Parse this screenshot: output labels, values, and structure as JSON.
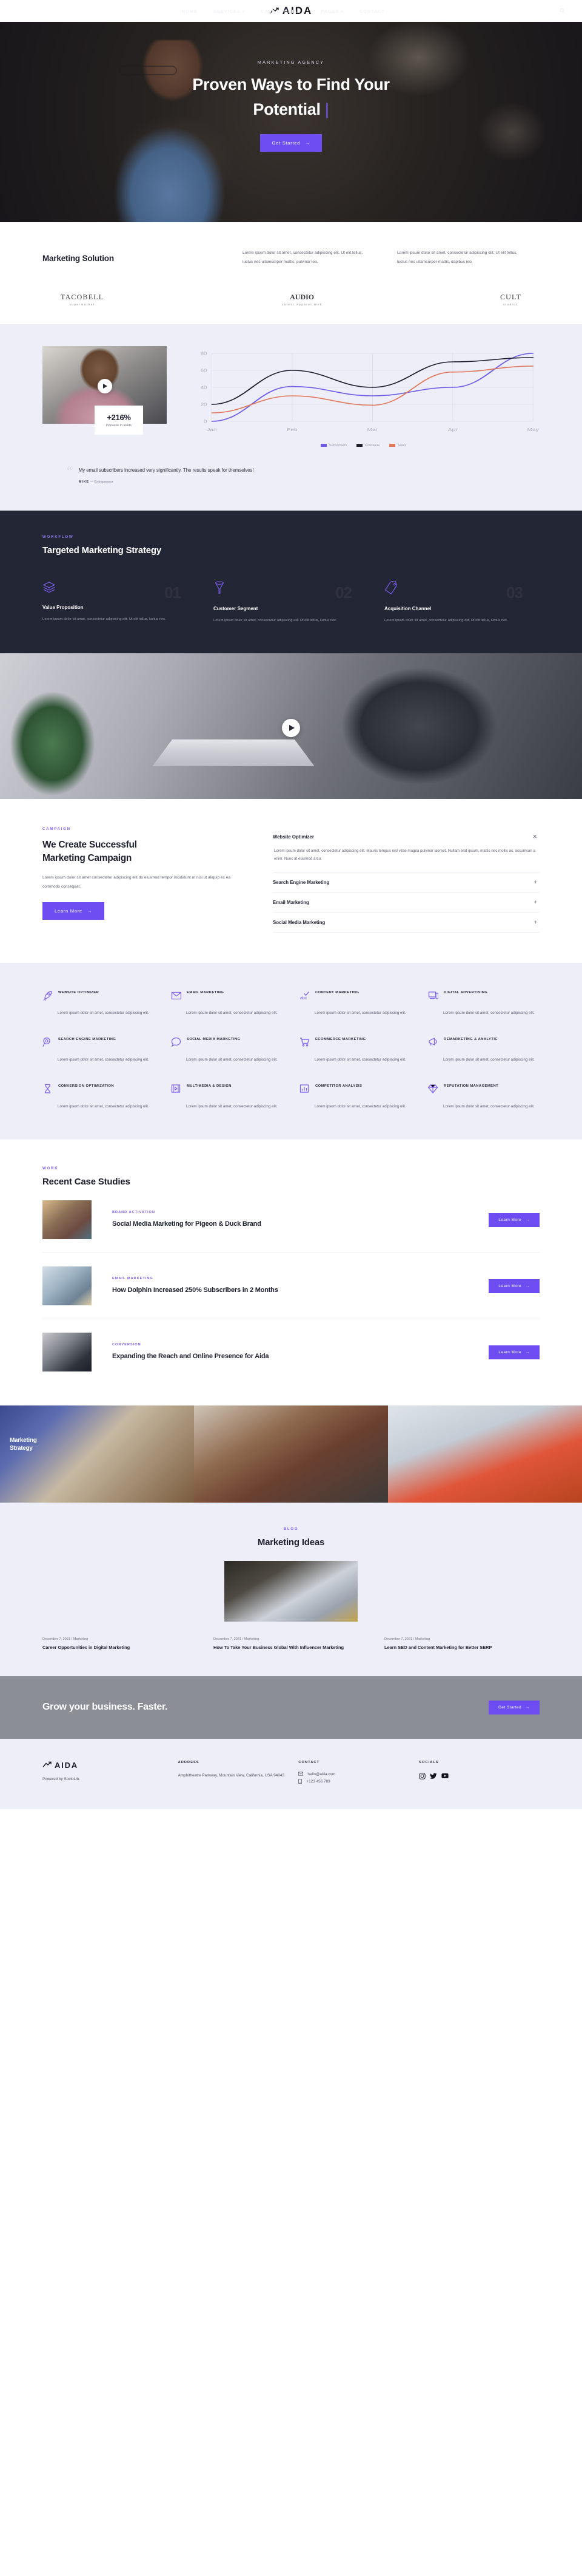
{
  "brand": {
    "name": "AIDA",
    "mark_icon": "trend-up-icon"
  },
  "nav": {
    "items": [
      {
        "label": "HOME",
        "has_caret": false
      },
      {
        "label": "SERVICES",
        "has_caret": true
      },
      {
        "label": "CASE STUDIES",
        "has_caret": true
      },
      {
        "label": "PAGES",
        "has_caret": true
      },
      {
        "label": "CONTACT",
        "has_caret": false
      }
    ],
    "search_icon": "search-icon"
  },
  "hero": {
    "eyebrow": "MARKETING AGENCY",
    "title_line1": "Proven Ways to Find Your",
    "title_line2": "Potential",
    "caret": "|",
    "cta": "Get Started",
    "cta_arrow": "→"
  },
  "solution": {
    "heading": "Marketing Solution",
    "col1": "Lorem ipsum dolor sit amet, consectetur adipiscing elit. Ut elit tellus, luctus nec ullamcorper mattis, pulvinar leo.",
    "col2": "Lorem ipsum dolor sit amet, consectetur adipiscing elit. Ut elit tellus, luctus nec ullamcorper mattis, dapibus leo.",
    "logos": [
      {
        "name": "TACOBELL",
        "sub": "supermarket"
      },
      {
        "name": "AUDIO",
        "sub": "Latest Apparel Web"
      },
      {
        "name": "CULT",
        "sub": "studios"
      }
    ]
  },
  "chart_section": {
    "stat_value": "+216%",
    "stat_label": "increase in leads",
    "play_icon": "play-icon",
    "quote": "My email subscribers increased very significantly. The results speak for themselves!",
    "quote_author": "MIKE",
    "quote_dash": "—",
    "quote_role": "Entrepeneur"
  },
  "chart_data": {
    "type": "line",
    "title": "",
    "xlabel": "",
    "ylabel": "",
    "x": [
      "Jan",
      "Feb",
      "Mar",
      "Apr",
      "May"
    ],
    "ylim": [
      0,
      80
    ],
    "yticks": [
      0,
      20,
      40,
      60,
      80
    ],
    "grid": true,
    "legend_position": "bottom",
    "series": [
      {
        "name": "Subscribers",
        "color": "#6c5ce7",
        "values": [
          0,
          41,
          30,
          40,
          80
        ]
      },
      {
        "name": "Followers",
        "color": "#1d1f2e",
        "values": [
          20,
          60,
          40,
          70,
          75
        ]
      },
      {
        "name": "Sales",
        "color": "#e0795b",
        "values": [
          10,
          30,
          19,
          58,
          65
        ]
      }
    ]
  },
  "workflow": {
    "eyebrow": "WORKFLOW",
    "heading": "Targeted Marketing Strategy",
    "steps": [
      {
        "num": "01",
        "icon": "layers-icon",
        "title": "Value Proposition",
        "desc": "Lorem ipsum dolor sit amet, consectetur adipiscing elit. Ut elit tellus, luctus nec."
      },
      {
        "num": "02",
        "icon": "funnel-icon",
        "title": "Customer Segment",
        "desc": "Lorem ipsum dolor sit amet, consectetur adipiscing elit. Ut elit tellus, luctus nec."
      },
      {
        "num": "03",
        "icon": "tag-icon",
        "title": "Acquisition Channel",
        "desc": "Lorem ipsum dolor sit amet, consectetur adipiscing elit. Ut elit tellus, luctus nec."
      }
    ]
  },
  "banner": {
    "play_icon": "play-icon"
  },
  "campaign": {
    "eyebrow": "CAMPAIGN",
    "heading_line1": "We Create Successful",
    "heading_line2": "Marketing Campaign",
    "desc": "Lorem ipsum dolor sit amet consectetur adipiscing elit do eiusmod tempor incididunt ut  nisi ut aliquip ex ea commodo consequat.",
    "cta": "Learn More",
    "cta_arrow": "→",
    "accordion": [
      {
        "title": "Website Optimizer",
        "sign": "✕",
        "open": true,
        "body": "Lorem ipsum dolor sit amet, consectetur adipiscing elit. Mauris tempus nisl vitae magna pulvinar laoreet. Nullam erat ipsum, mattis nec mollis ac, accumsan a enim. Nunc at euismod arcu."
      },
      {
        "title": "Search Engine Marketing",
        "sign": "+",
        "open": false,
        "body": ""
      },
      {
        "title": "Email Marketing",
        "sign": "+",
        "open": false,
        "body": ""
      },
      {
        "title": "Social Media Marketing",
        "sign": "+",
        "open": false,
        "body": ""
      }
    ]
  },
  "services": {
    "items": [
      {
        "icon": "rocket-icon",
        "name": "WEBSITE OPTIMIZER",
        "desc": "Lorem ipsum dolor sit amet, consectetur adipiscing elit."
      },
      {
        "icon": "envelope-icon",
        "name": "EMAIL MARKETING",
        "desc": "Lorem ipsum dolor sit amet, consectetur adipiscing elit."
      },
      {
        "icon": "abc-check-icon",
        "name": "CONTENT MARKETING",
        "desc": "Lorem ipsum dolor sit amet, consectetur adipiscing elit."
      },
      {
        "icon": "devices-icon",
        "name": "DIGITAL ADVERTISING",
        "desc": "Lorem ipsum dolor sit amet, consectetur adipiscing elit."
      },
      {
        "icon": "magnifier-icon",
        "name": "SEARCH ENGINE MARKETING",
        "desc": "Lorem ipsum dolor sit amet, consectetur adipiscing elit."
      },
      {
        "icon": "chat-bubble-icon",
        "name": "SOCIAL MEDIA MARKETING",
        "desc": "Lorem ipsum dolor sit amet, consectetur adipiscing elit."
      },
      {
        "icon": "cart-icon",
        "name": "ECOMMERCE MARKETING",
        "desc": "Lorem ipsum dolor sit amet, consectetur adipiscing elit."
      },
      {
        "icon": "megaphone-icon",
        "name": "REMARKETING & ANALYTIC",
        "desc": "Lorem ipsum dolor sit amet, consectetur adipiscing elit."
      },
      {
        "icon": "hourglass-icon",
        "name": "CONVERSION OPTIMIZATION",
        "desc": "Lorem ipsum dolor sit amet, consectetur adipiscing elit."
      },
      {
        "icon": "film-icon",
        "name": "MULTIMEDIA & DESIGN",
        "desc": "Lorem ipsum dolor sit amet, consectetur adipiscing elit."
      },
      {
        "icon": "bar-chart-icon",
        "name": "COMPETITOR ANALYSIS",
        "desc": "Lorem ipsum dolor sit amet, consectetur adipiscing elit."
      },
      {
        "icon": "diamond-icon",
        "name": "REPUTATION MANAGEMENT",
        "desc": "Lorem ipsum dolor sit amet, consectetur adipiscing elit."
      }
    ]
  },
  "cases": {
    "eyebrow": "WORK",
    "heading": "Recent Case Studies",
    "button_label": "Learn More",
    "button_arrow": "→",
    "items": [
      {
        "tag": "BRAND ACTIVATION",
        "title": "Social Media Marketing for Pigeon & Duck Brand"
      },
      {
        "tag": "EMAIL MARKETING",
        "title": "How Dolphin Increased 250% Subscribers in 2 Months"
      },
      {
        "tag": "CONVERSION",
        "title": "Expanding the Reach and Online Presence for Aida"
      }
    ]
  },
  "strip": {
    "p1_caption": "Marketing Strategy"
  },
  "blog": {
    "eyebrow": "BLOG",
    "heading": "Marketing Ideas",
    "posts": [
      {
        "date": "December 7, 2021",
        "sep": "/",
        "cat": "Marketing",
        "title": "Career Opportunities in Digital Marketing"
      },
      {
        "date": "December 7, 2021",
        "sep": "/",
        "cat": "Marketing",
        "title": "How To Take Your Business Global With Influencer Marketing"
      },
      {
        "date": "December 7, 2021",
        "sep": "/",
        "cat": "Marketing",
        "title": "Learn SEO and Content Marketing for Better SERP"
      }
    ]
  },
  "cta": {
    "heading": "Grow your business. Faster.",
    "button": "Get Started",
    "arrow": "→"
  },
  "footer": {
    "brand": "AIDA",
    "powered": "Powered by SocioLib.",
    "address_head": "ADDRESS",
    "address_body": "Amphitheatre Parkway, Mountain View, California, USA 94043",
    "contact_head": "CONTACT",
    "email": "hello@aida.com",
    "phone": "+123 456 789",
    "socials_head": "SOCIALS",
    "social_icons": [
      "instagram-icon",
      "twitter-icon",
      "youtube-icon"
    ]
  },
  "colors": {
    "accent": "#6d4df2",
    "dark": "#232634",
    "light_bg": "#eeeef8",
    "cta_bg": "#8c8e95"
  }
}
